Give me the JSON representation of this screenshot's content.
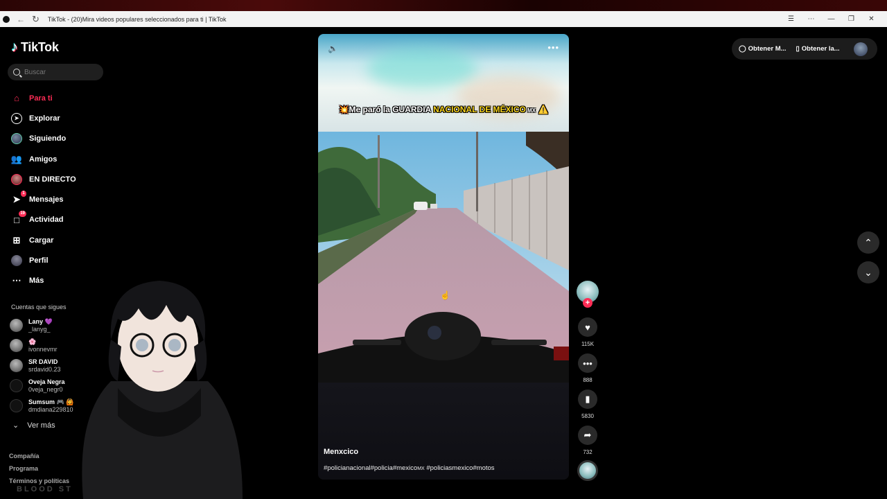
{
  "browser": {
    "title": "TikTok - (20)Mira videos populares seleccionados para ti | TikTok"
  },
  "sidebar": {
    "logo": "TikTok",
    "search_placeholder": "Buscar",
    "items": [
      {
        "label": "Para ti",
        "icon": "home-icon",
        "active": true
      },
      {
        "label": "Explorar",
        "icon": "compass-icon"
      },
      {
        "label": "Siguiendo",
        "icon": "following-avatar-icon"
      },
      {
        "label": "Amigos",
        "icon": "friends-icon"
      },
      {
        "label": "EN DIRECTO",
        "icon": "live-avatar-icon"
      },
      {
        "label": "Mensajes",
        "icon": "messages-icon",
        "badge": "1"
      },
      {
        "label": "Actividad",
        "icon": "activity-icon",
        "badge": "19"
      },
      {
        "label": "Cargar",
        "icon": "upload-icon"
      },
      {
        "label": "Perfil",
        "icon": "profile-avatar-icon"
      },
      {
        "label": "Más",
        "icon": "more-icon"
      }
    ],
    "following_title": "Cuentas que sigues",
    "following": [
      {
        "name": "Lany 💜",
        "handle": "_lanyg_"
      },
      {
        "name": "🌸",
        "handle": "ivonnevmr"
      },
      {
        "name": "SR DAVID",
        "handle": "srdavid0.23"
      },
      {
        "name": "Oveja Negra",
        "handle": "0veja_negr0"
      },
      {
        "name": "Sumsum 🎮 🙆",
        "handle": "dmdiana229810"
      }
    ],
    "see_more": "Ver más",
    "footer": [
      "Compañía",
      "Programa",
      "Términos y políticas"
    ]
  },
  "video": {
    "caption_parts": [
      "💥Me paró la GUARDIA ",
      "NACIONAL DE MÉXICO",
      " MX",
      " ⚠️"
    ],
    "author": "Menxcico",
    "tags_a": "#policianacional#policia#mexico",
    "tags_small": "MX",
    "tags_b": " #policiasmexico#motos"
  },
  "actions": {
    "likes": "115K",
    "comments": "888",
    "saves": "5830",
    "shares": "732"
  },
  "topright": {
    "item1": "Obtener M...",
    "item2": "Obtener la..."
  },
  "overlay_text": "BLOOD ST"
}
